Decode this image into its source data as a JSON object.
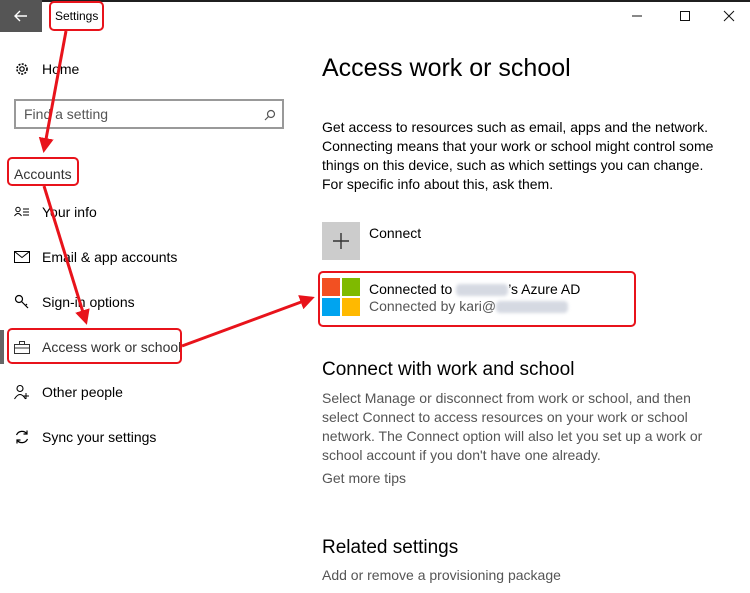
{
  "window": {
    "title": "Settings",
    "controls": {
      "minimize": "—",
      "maximize": "☐",
      "close": "✕"
    }
  },
  "sidebar": {
    "home_label": "Home",
    "search_placeholder": "Find a setting",
    "section_label": "Accounts",
    "items": [
      {
        "label": "Your info",
        "icon": "person-card-icon"
      },
      {
        "label": "Email & app accounts",
        "icon": "mail-icon"
      },
      {
        "label": "Sign-in options",
        "icon": "key-icon"
      },
      {
        "label": "Access work or school",
        "icon": "briefcase-icon",
        "selected": true
      },
      {
        "label": "Other people",
        "icon": "person-add-icon"
      },
      {
        "label": "Sync your settings",
        "icon": "sync-icon"
      }
    ]
  },
  "main": {
    "title": "Access work or school",
    "description": "Get access to resources such as email, apps and the network. Connecting means that your work or school might control some things on this device, such as which settings you can change. For specific info about this, ask them.",
    "connect_label": "Connect",
    "account": {
      "line1_prefix": "Connected to",
      "line1_suffix": "’s Azure AD",
      "line2_prefix": "Connected by kari@"
    },
    "section2_title": "Connect with work and school",
    "section2_text": "Select Manage or disconnect from work or school, and then select Connect to access resources on your work or school network. The Connect option will also let you set up a work or school account if you don't have one already.",
    "tips_link": "Get more tips",
    "related_title": "Related settings",
    "related_link": "Add or remove a provisioning package"
  },
  "colors": {
    "annotation_red": "#e8131b",
    "ms_red": "#f25022",
    "ms_green": "#7fba00",
    "ms_blue": "#00a4ef",
    "ms_yellow": "#ffb900"
  }
}
